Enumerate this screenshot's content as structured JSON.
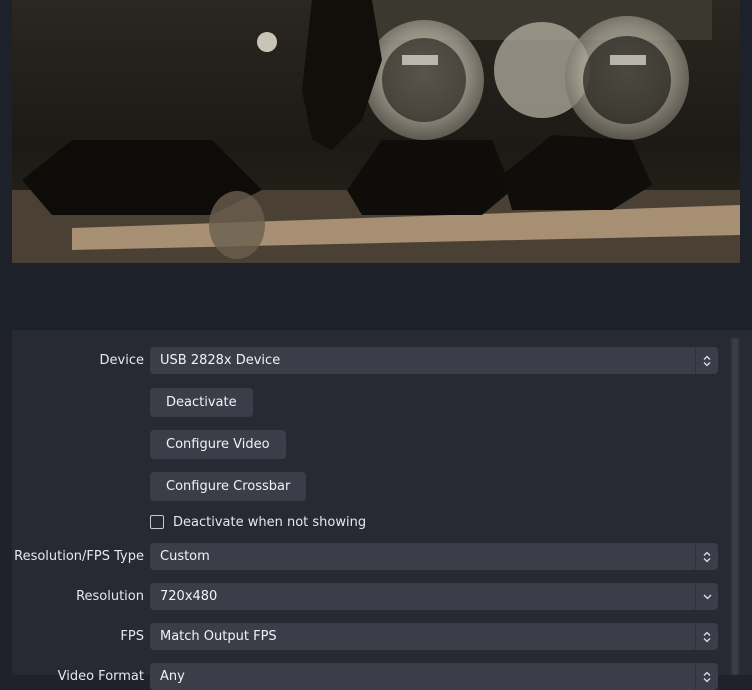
{
  "properties": {
    "device": {
      "label": "Device",
      "value": "USB 2828x Device"
    },
    "buttons": {
      "deactivate": "Deactivate",
      "configure_video": "Configure Video",
      "configure_crossbar": "Configure Crossbar"
    },
    "deactivate_when_not_showing": {
      "label": "Deactivate when not showing",
      "checked": false
    },
    "resolution_fps_type": {
      "label": "Resolution/FPS Type",
      "value": "Custom"
    },
    "resolution": {
      "label": "Resolution",
      "value": "720x480"
    },
    "fps": {
      "label": "FPS",
      "value": "Match Output FPS"
    },
    "video_format": {
      "label": "Video Format",
      "value": "Any"
    }
  },
  "colors": {
    "panel_bg": "#272a33",
    "control_bg": "#3b3e48",
    "preview_bg": "#1d212a"
  }
}
